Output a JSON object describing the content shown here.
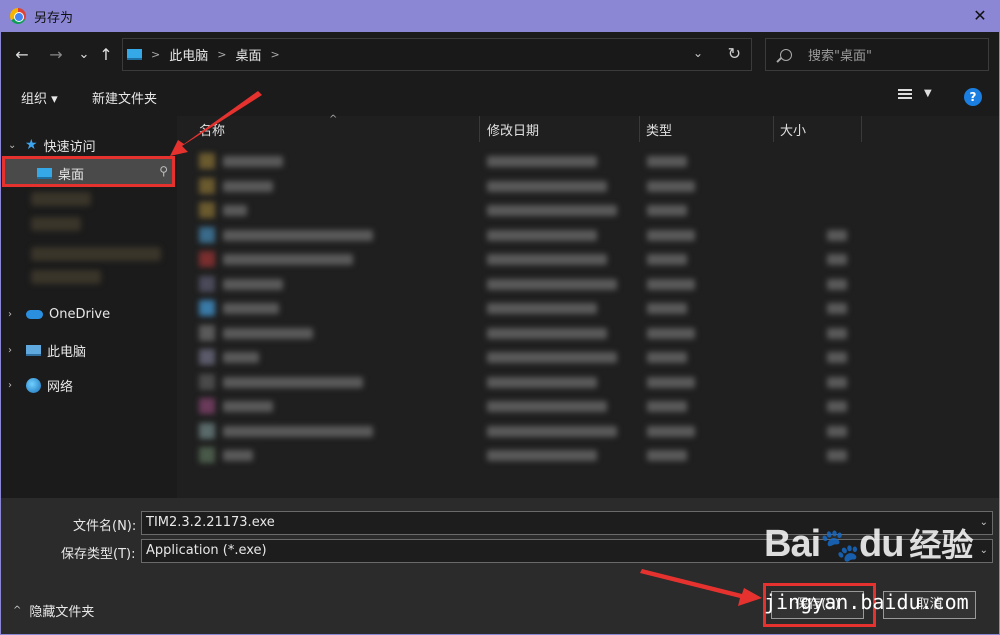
{
  "window": {
    "title": "另存为",
    "close_glyph": "✕"
  },
  "nav": {
    "back": "←",
    "forward": "→",
    "recent": "⌄",
    "up": "↑",
    "breadcrumb": [
      "此电脑",
      "桌面"
    ],
    "search_placeholder": "搜索\"桌面\""
  },
  "toolbar": {
    "organize": "组织 ▾",
    "new_folder": "新建文件夹",
    "help": "?"
  },
  "sidebar": {
    "quick_access": "快速访问",
    "desktop": "桌面",
    "onedrive": "OneDrive",
    "this_pc": "此电脑",
    "network": "网络"
  },
  "columns": {
    "name": "名称",
    "modified": "修改日期",
    "type": "类型",
    "size": "大小"
  },
  "bottom": {
    "filename_label": "文件名(N):",
    "filename_value": "TIM2.3.2.21173.exe",
    "filetype_label": "保存类型(T):",
    "filetype_value": "Application (*.exe)",
    "hide_folders": "隐藏文件夹",
    "save_button": "保存(S)",
    "cancel_button": "取消"
  },
  "watermark": {
    "logo": "Bai",
    "logo_suffix": "du",
    "cn": "经验",
    "url": "jingyan.baidu.com"
  },
  "colors": {
    "titlebar": "#8b87d4",
    "highlight": "#e6322f",
    "accent": "#35a8e8"
  }
}
